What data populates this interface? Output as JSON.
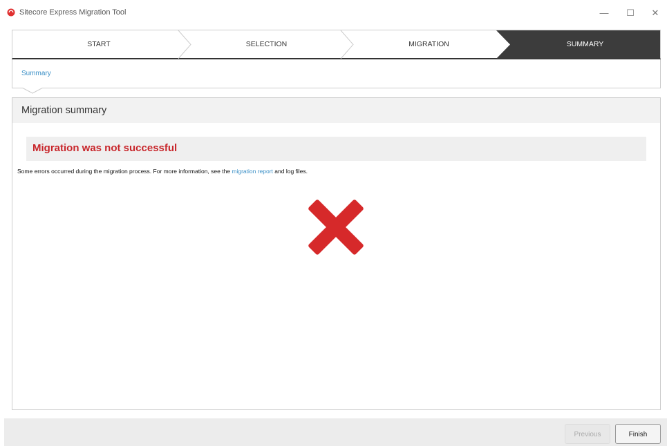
{
  "window": {
    "title": "Sitecore Express Migration Tool",
    "minimize_glyph": "—",
    "maximize_glyph": "☐",
    "close_glyph": "✕",
    "brand_color": "#e03030"
  },
  "wizard": {
    "steps": [
      {
        "label": "START",
        "active": false
      },
      {
        "label": "SELECTION",
        "active": false
      },
      {
        "label": "MIGRATION",
        "active": false
      },
      {
        "label": "SUMMARY",
        "active": true
      }
    ],
    "active_color": "#3c3c3c"
  },
  "breadcrumb": {
    "label": "Summary"
  },
  "panel": {
    "title": "Migration summary",
    "error_title": "Migration was not successful",
    "error_text_before": "Some errors occurred during the migration process. For more information, see the ",
    "error_link": "migration report",
    "error_text_after": " and log files.",
    "status_icon": "error-x-icon",
    "error_color": "#d6292a"
  },
  "footer": {
    "previous_label": "Previous",
    "previous_enabled": false,
    "finish_label": "Finish"
  }
}
